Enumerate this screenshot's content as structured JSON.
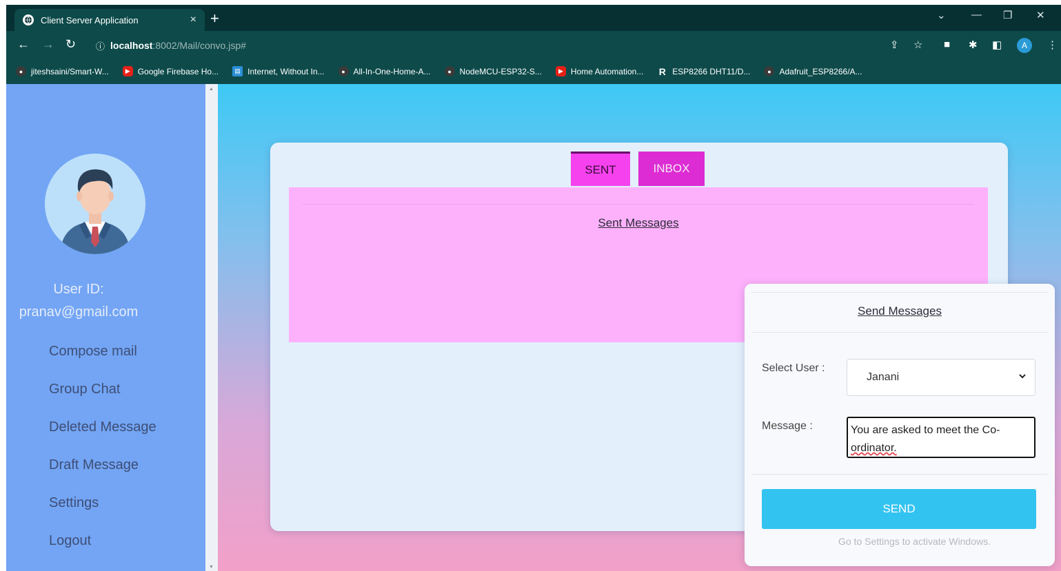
{
  "browser": {
    "tab_title": "Client Server Application",
    "tab_close": "×",
    "new_tab": "+",
    "url_host": "localhost",
    "url_path": ":8002/Mail/convo.jsp#",
    "profile_initial": "A",
    "bookmarks": [
      {
        "label": "jiteshsaini/Smart-W...",
        "icon": "github-icon",
        "color": "#3a3a3a"
      },
      {
        "label": "Google Firebase Ho...",
        "icon": "youtube-icon",
        "color": "#e62117"
      },
      {
        "label": "Internet, Without In...",
        "icon": "page-icon",
        "color": "#2a8fd8"
      },
      {
        "label": "All-In-One-Home-A...",
        "icon": "github-icon",
        "color": "#3a3a3a"
      },
      {
        "label": "NodeMCU-ESP32-S...",
        "icon": "github-icon",
        "color": "#3a3a3a"
      },
      {
        "label": "Home Automation...",
        "icon": "youtube-icon",
        "color": "#e62117"
      },
      {
        "label": "ESP8266 DHT11/D...",
        "icon": "r-icon",
        "color": "#0e4a4a"
      },
      {
        "label": "Adafruit_ESP8266/A...",
        "icon": "github-icon",
        "color": "#3a3a3a"
      }
    ]
  },
  "sidebar": {
    "user_id_label": "User ID:",
    "user_id_value": "pranav@gmail.com",
    "nav": {
      "compose": "Compose mail",
      "group_chat": "Group Chat",
      "deleted": "Deleted Message",
      "draft": "Draft Message",
      "settings": "Settings",
      "logout": "Logout"
    }
  },
  "main": {
    "tabs": {
      "sent": "SENT",
      "inbox": "INBOX"
    },
    "messages_title": "Sent Messages"
  },
  "send_panel": {
    "title": "Send Messages",
    "select_user_label": "Select User :",
    "selected_user": "Janani",
    "message_label": "Message :",
    "message_text_1": "You are asked to meet the Co-",
    "message_text_2": "ordinator.",
    "send_button": "SEND",
    "watermark_line": "Go to Settings to activate Windows."
  },
  "colors": {
    "sidebar": "#73a5f4",
    "sent_tab": "#f542ee",
    "inbox_tab": "#dd2cd3",
    "messages_panel": "#fdb1fb",
    "send_button": "#33c3f0"
  }
}
